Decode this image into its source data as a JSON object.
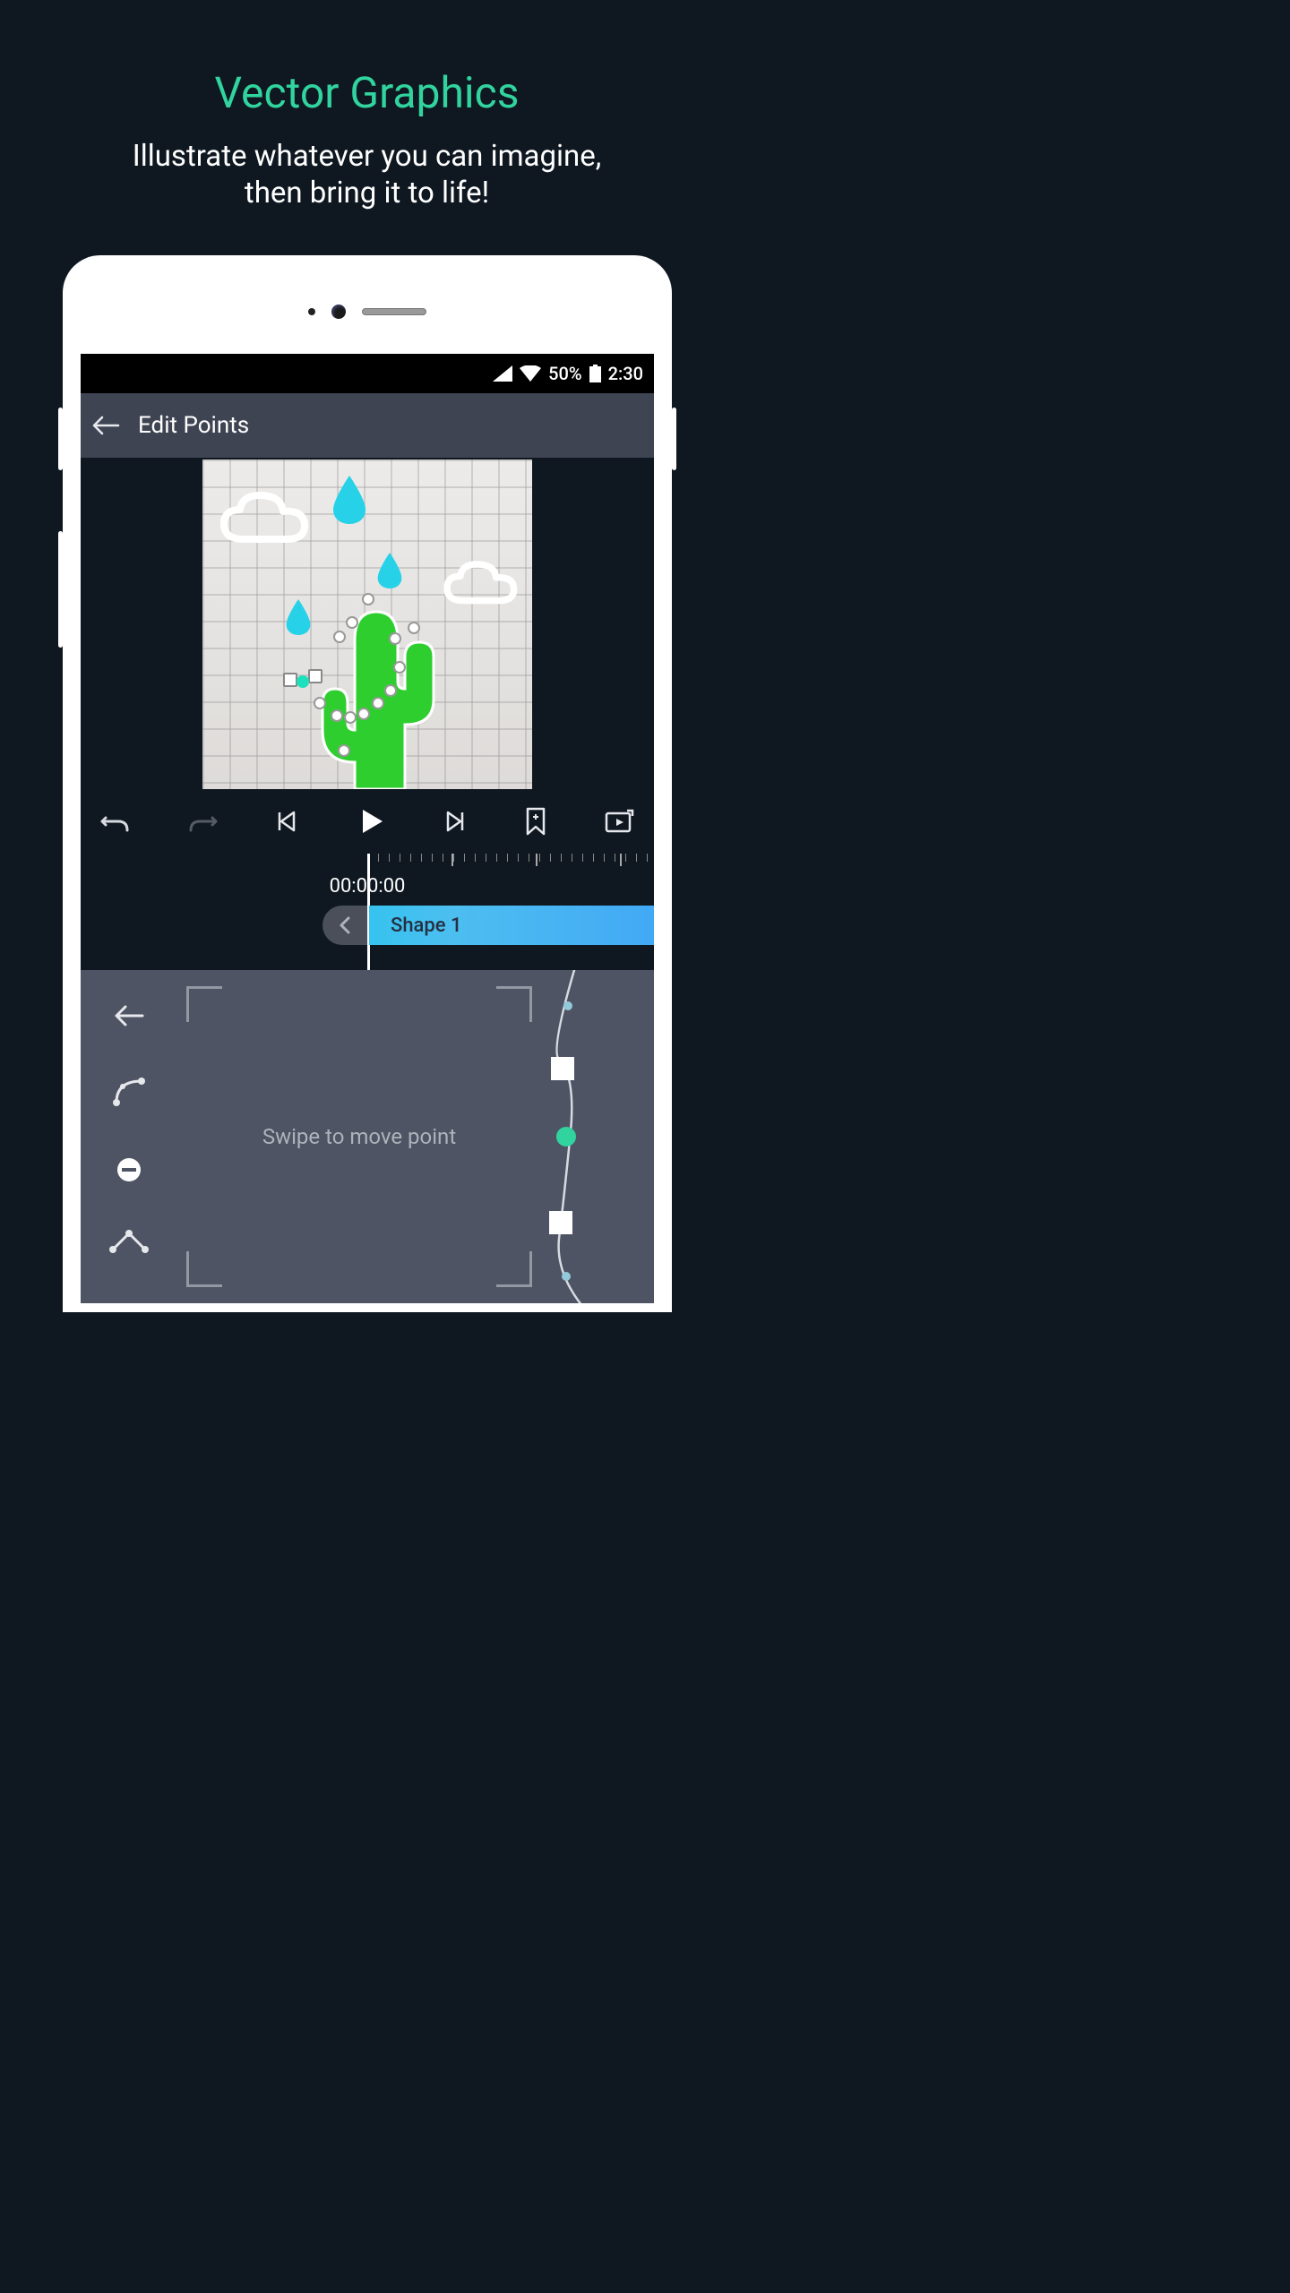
{
  "promo": {
    "title": "Vector Graphics",
    "subtitle": "Illustrate whatever you can imagine,\nthen bring it to life!"
  },
  "status": {
    "battery_pct": "50%",
    "time": "2:30"
  },
  "screen": {
    "title": "Edit Points",
    "timeline": {
      "current": "00:00:00",
      "track_label": "Shape 1"
    },
    "hint": "Swipe to move point"
  },
  "tools": {
    "back": "back",
    "curve": "curve",
    "delete": "delete-point",
    "corner": "corner-point"
  }
}
